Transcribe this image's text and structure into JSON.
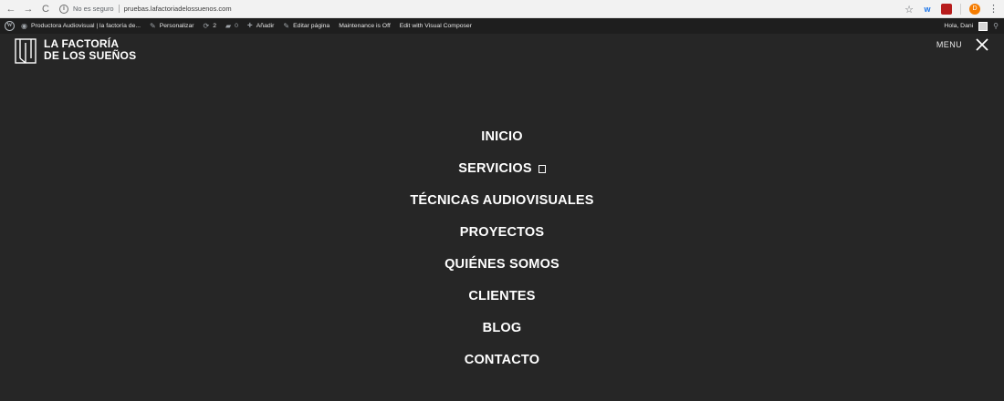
{
  "browser": {
    "back_icon": "←",
    "forward_icon": "→",
    "reload_icon": "C",
    "info_icon": "i",
    "insecure_label": "No es seguro",
    "url": "pruebas.lafactoriadelossuenos.com",
    "star_icon": "☆",
    "ext1_icon": "w",
    "ext3_icon": "D",
    "menu_icon": "⋮"
  },
  "admin_bar": {
    "wp_icon": "W",
    "site_name": "Productora Audiovisual | la factoría de...",
    "customize": "Personalizar",
    "updates_count": "2",
    "comments_count": "0",
    "new": "Añadir",
    "edit_page": "Editar página",
    "maintenance": "Maintenance is Off",
    "visual_composer": "Edit with Visual Composer",
    "greeting": "Hola, Dani"
  },
  "header": {
    "logo_line1": "LA FACTORÍA",
    "logo_line2": "DE LOS SUEÑOS",
    "menu_label": "MENU"
  },
  "nav": {
    "items": [
      {
        "label": "INICIO"
      },
      {
        "label": "SERVICIOS"
      },
      {
        "label": "TÉCNICAS AUDIOVISUALES"
      },
      {
        "label": "PROYECTOS"
      },
      {
        "label": "QUIÉNES SOMOS"
      },
      {
        "label": "CLIENTES"
      },
      {
        "label": "BLOG"
      },
      {
        "label": "CONTACTO"
      }
    ]
  },
  "colors": {
    "background": "#262626",
    "admin_bar": "#1e1e1e",
    "text": "#ffffff"
  }
}
